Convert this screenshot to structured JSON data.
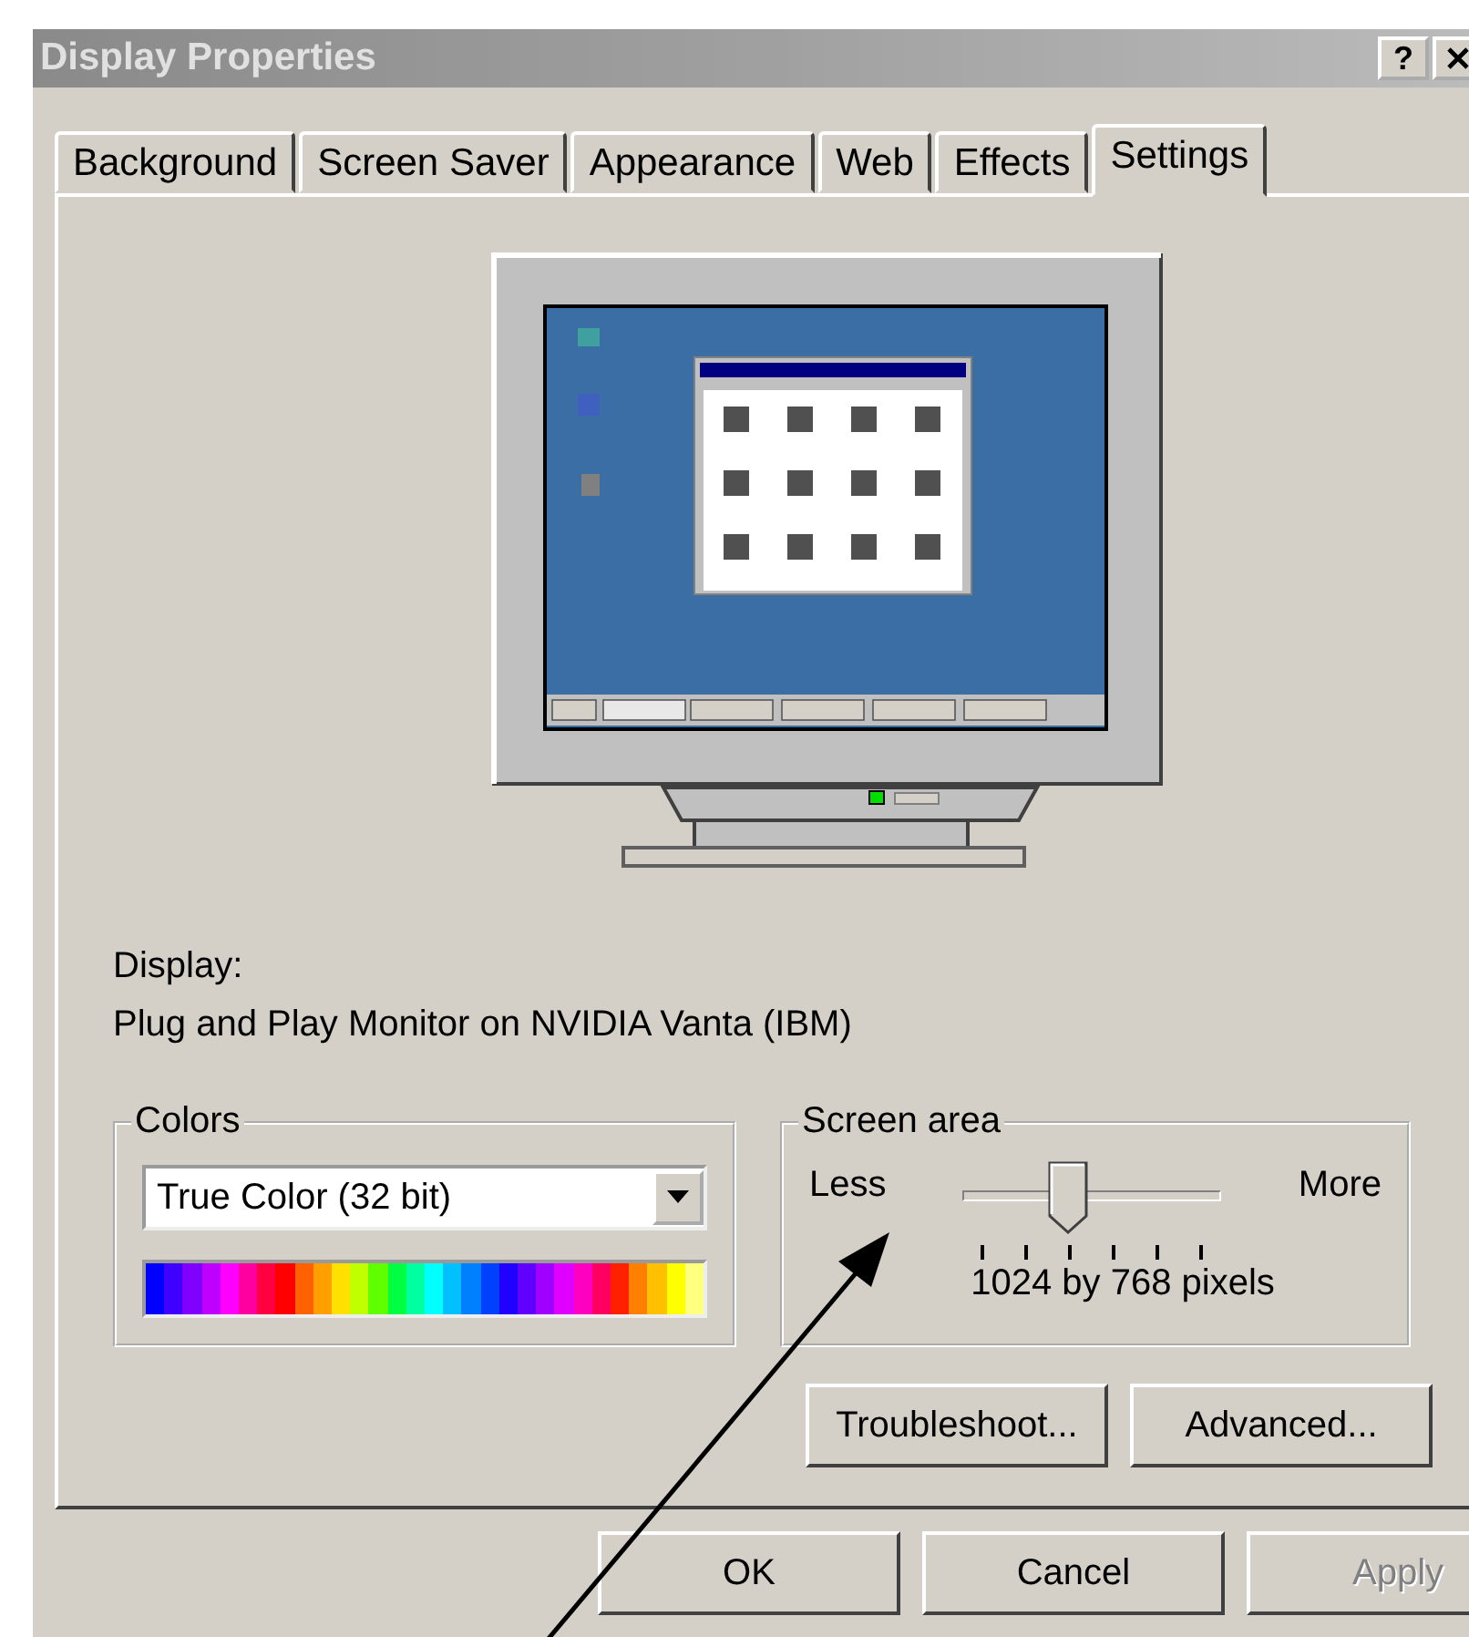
{
  "window": {
    "title": "Display Properties",
    "help_button": "?"
  },
  "tabs": [
    {
      "label": "Background",
      "selected": false
    },
    {
      "label": "Screen Saver",
      "selected": false
    },
    {
      "label": "Appearance",
      "selected": false
    },
    {
      "label": "Web",
      "selected": false
    },
    {
      "label": "Effects",
      "selected": false
    },
    {
      "label": "Settings",
      "selected": true
    }
  ],
  "display": {
    "label": "Display:",
    "value": "Plug and Play Monitor on NVIDIA Vanta (IBM)"
  },
  "colors": {
    "title": "Colors",
    "value": "True Color (32 bit)"
  },
  "screen_area": {
    "title": "Screen area",
    "min_label": "Less",
    "max_label": "More",
    "level": 0.4,
    "reading": "1024 by 768 pixels"
  },
  "panel_buttons": [
    {
      "label": "Troubleshoot...",
      "disabled": false
    },
    {
      "label": "Advanced...",
      "disabled": false
    }
  ],
  "buttons": [
    {
      "label": "OK",
      "disabled": false
    },
    {
      "label": "Cancel",
      "disabled": false
    },
    {
      "label": "Apply",
      "disabled": true
    }
  ]
}
